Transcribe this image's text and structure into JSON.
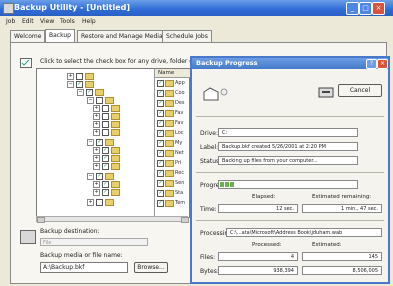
{
  "window": {
    "title": "Backup Utility - [Untitled]"
  },
  "titlebar_buttons": {
    "min": "_",
    "max": "□",
    "close": "×"
  },
  "menu": [
    "Job",
    "Edit",
    "View",
    "Tools",
    "Help"
  ],
  "tabs": [
    "Welcome",
    "Backup",
    "Restore and Manage Media",
    "Schedule Jobs"
  ],
  "backup_tab": {
    "hint": "Click to select the check box for any drive, folder or file",
    "name_column": "Name",
    "file_items": [
      "App",
      "Coo",
      "Des",
      "Fav",
      "Fav",
      "Loc",
      "My",
      "Net",
      "Pri",
      "Rec",
      "Sen",
      "Sta",
      "Tem"
    ],
    "destination_label": "Backup destination:",
    "destination_value": "File",
    "media_label": "Backup media or file name:",
    "media_value": "A:\\Backup.bkf",
    "browse_label": "Browse..."
  },
  "dialog": {
    "title": "Backup Progress",
    "help": "?",
    "close": "×",
    "cancel_label": "Cancel",
    "drive_label": "Drive:",
    "drive_value": "C:",
    "label_label": "Label:",
    "label_value": "Backup.bkf created 5/26/2001 at 2:20 PM",
    "status_label": "Status:",
    "status_value": "Backing up files from your computer...",
    "progress_label": "Progress:",
    "progress_fraction": 0.11,
    "elapsed_header": "Elapsed:",
    "remaining_header": "Estimated remaining:",
    "time_label": "Time:",
    "elapsed_value": "12 sec.",
    "remaining_value": "1 min., 47 sec.",
    "processing_label": "Processing:",
    "processing_value": "C:\\...ata\\Microsoft\\Address Book\\jduham.wab",
    "processed_header": "Processed:",
    "estimated_header": "Estimated:",
    "files_label": "Files:",
    "files_processed": "4",
    "files_estimated": "145",
    "bytes_label": "Bytes:",
    "bytes_processed": "938,394",
    "bytes_estimated": "8,506,005"
  }
}
